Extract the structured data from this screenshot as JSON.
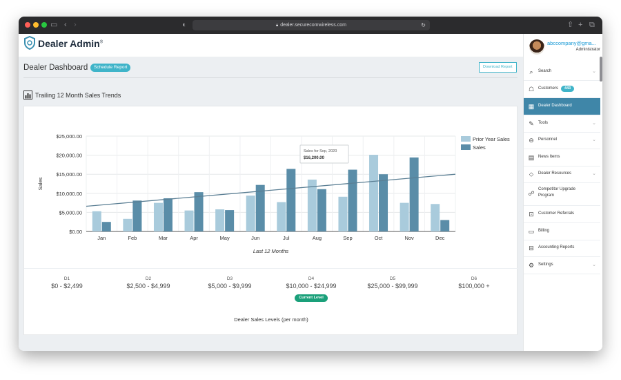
{
  "browser": {
    "url": "dealer.securecomwireless.com",
    "traffic_colors": [
      "#ff5f57",
      "#febc2e",
      "#28c840"
    ]
  },
  "header": {
    "logo_text": "Dealer Admin",
    "logo_tm": "®",
    "user_email": "abccompany@gma...",
    "user_role": "Administrator"
  },
  "page": {
    "title": "Dealer Dashboard",
    "schedule_label": "Schedule Report",
    "download_label": "Download Report",
    "section_title": "Trailing 12 Month Sales Trends"
  },
  "chart_data": {
    "type": "bar",
    "categories": [
      "Jan",
      "Feb",
      "Mar",
      "Apr",
      "May",
      "Jun",
      "Jul",
      "Aug",
      "Sep",
      "Oct",
      "Nov",
      "Dec"
    ],
    "series": [
      {
        "name": "Prior Year Sales",
        "color": "#a9cbdc",
        "values": [
          5300,
          3300,
          7500,
          5500,
          5800,
          9400,
          7700,
          13600,
          9100,
          20100,
          7500,
          7200
        ]
      },
      {
        "name": "Sales",
        "color": "#5a8da8",
        "values": [
          2500,
          8100,
          8700,
          10300,
          5600,
          12200,
          16400,
          11100,
          16200,
          15000,
          19400,
          3000
        ]
      }
    ],
    "trendline": {
      "color": "#5b7f94",
      "start": 6600,
      "end": 15000
    },
    "ylabel": "Sales",
    "xlabel": "Last 12 Months",
    "ylim": [
      0,
      25000
    ],
    "yticks": [
      "$0.00",
      "$5,000.00",
      "$10,000.00",
      "$15,000.00",
      "$20,000.00",
      "$25,000.00"
    ],
    "ytick_values": [
      0,
      5000,
      10000,
      15000,
      20000,
      25000
    ],
    "grid": true,
    "legend": "top-right",
    "tooltip": {
      "title": "Sales for Sep, 2020",
      "value": "$16,200.00",
      "category_index": 8
    }
  },
  "levels": {
    "items": [
      {
        "code": "D1",
        "range": "$0 - $2,499"
      },
      {
        "code": "D2",
        "range": "$2,500 - $4,999"
      },
      {
        "code": "D3",
        "range": "$5,000 - $9,999"
      },
      {
        "code": "D4",
        "range": "$10,000 - $24,999"
      },
      {
        "code": "D5",
        "range": "$25,000 - $99,999"
      },
      {
        "code": "D6",
        "range": "$100,000 +"
      }
    ],
    "current_label": "Current Level",
    "caption": "Dealer Sales Levels (per month)"
  },
  "sidebar": {
    "items": [
      {
        "label": "Search",
        "icon": "search-icon",
        "glyph": "⌕"
      },
      {
        "label": "Customers",
        "icon": "customers-icon",
        "glyph": "☖",
        "badge": "443"
      },
      {
        "label": "Dealer Dashboard",
        "icon": "dashboard-icon",
        "glyph": "▦"
      },
      {
        "label": "Tools",
        "icon": "tools-icon",
        "glyph": "✎"
      },
      {
        "label": "Personnel",
        "icon": "personnel-icon",
        "glyph": "⊖"
      },
      {
        "label": "News Items",
        "icon": "news-icon",
        "glyph": "▤"
      },
      {
        "label": "Dealer Resources",
        "icon": "resources-icon",
        "glyph": "⬦"
      },
      {
        "label": "Competitor Upgrade Program",
        "icon": "upgrade-icon",
        "glyph": "☍"
      },
      {
        "label": "Customer Referrals",
        "icon": "referrals-icon",
        "glyph": "⊡"
      },
      {
        "label": "Billing",
        "icon": "billing-icon",
        "glyph": "▭"
      },
      {
        "label": "Accounting Reports",
        "icon": "accounting-icon",
        "glyph": "⊟"
      },
      {
        "label": "Settings",
        "icon": "settings-icon",
        "glyph": "⚙"
      }
    ]
  }
}
